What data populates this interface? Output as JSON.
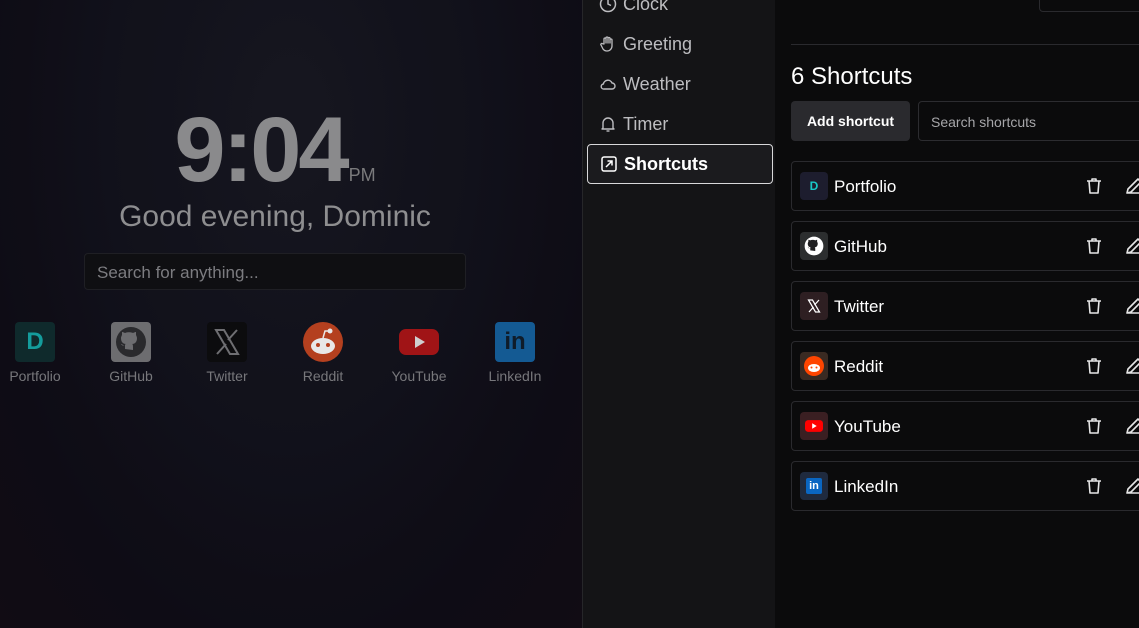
{
  "clock": {
    "time": "9:04",
    "ampm": "PM"
  },
  "greeting": "Good evening, Dominic",
  "search_placeholder": "Search for anything...",
  "home_shortcuts": [
    {
      "label": "Portfolio",
      "icon": "portfolio-icon"
    },
    {
      "label": "GitHub",
      "icon": "github-icon"
    },
    {
      "label": "Twitter",
      "icon": "x-icon"
    },
    {
      "label": "Reddit",
      "icon": "reddit-icon"
    },
    {
      "label": "YouTube",
      "icon": "youtube-icon"
    },
    {
      "label": "LinkedIn",
      "icon": "linkedin-icon"
    }
  ],
  "nav": {
    "items": [
      {
        "label": "Clock",
        "icon": "clock-icon"
      },
      {
        "label": "Greeting",
        "icon": "hand-icon"
      },
      {
        "label": "Weather",
        "icon": "cloud-icon"
      },
      {
        "label": "Timer",
        "icon": "bell-icon"
      },
      {
        "label": "Shortcuts",
        "icon": "external-link-icon",
        "active": true
      }
    ]
  },
  "shortcuts_panel": {
    "title": "6 Shortcuts",
    "add_label": "Add shortcut",
    "search_placeholder": "Search shortcuts",
    "items": [
      {
        "name": "Portfolio",
        "icon": "portfolio-icon"
      },
      {
        "name": "GitHub",
        "icon": "github-icon"
      },
      {
        "name": "Twitter",
        "icon": "x-icon"
      },
      {
        "name": "Reddit",
        "icon": "reddit-icon"
      },
      {
        "name": "YouTube",
        "icon": "youtube-icon"
      },
      {
        "name": "LinkedIn",
        "icon": "linkedin-icon"
      }
    ]
  },
  "colors": {
    "portfolio": "#19c6c6",
    "github": "#ffffff",
    "reddit": "#ff4500",
    "youtube": "#ff0000",
    "linkedin": "#0a66c2"
  }
}
